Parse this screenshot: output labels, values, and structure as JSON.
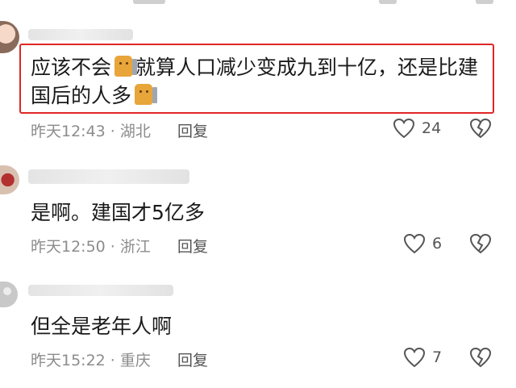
{
  "comments": [
    {
      "text_before_emoji": "应该不会",
      "text_after_emoji": "就算人口减少变成九到十亿，还是比建国后的人多",
      "time_location": "昨天12:43 · 湖北",
      "reply_label": "回复",
      "likes": "24"
    },
    {
      "text": "是啊。建国才5亿多",
      "time_location": "昨天12:50 · 浙江",
      "reply_label": "回复",
      "likes": "6"
    },
    {
      "text": "但全是老年人啊",
      "time_location": "昨天15:22 · 重庆",
      "reply_label": "回复",
      "likes": "7"
    }
  ],
  "colors": {
    "highlight_border": "#e02626",
    "meta_text": "#8c8c8c",
    "icon_stroke": "#555555"
  },
  "icons": [
    "heart-icon",
    "broken-heart-icon",
    "bear-emoji-icon"
  ]
}
